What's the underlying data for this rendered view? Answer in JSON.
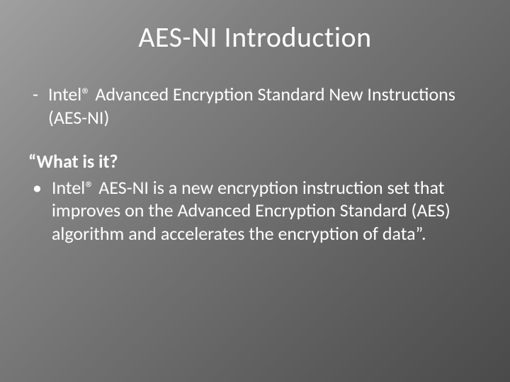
{
  "slide": {
    "title": "AES-NI Introduction",
    "dash_marker": "-",
    "intro": "Intel® Advanced Encryption Standard New Instructions (AES-NI)",
    "subhead": "“What is it?",
    "bullet_marker": "•",
    "bullet_text": "Intel® AES-NI is a new encryption instruction set that improves on the Advanced Encryption Standard (AES) algorithm and accelerates the encryption of data”."
  }
}
